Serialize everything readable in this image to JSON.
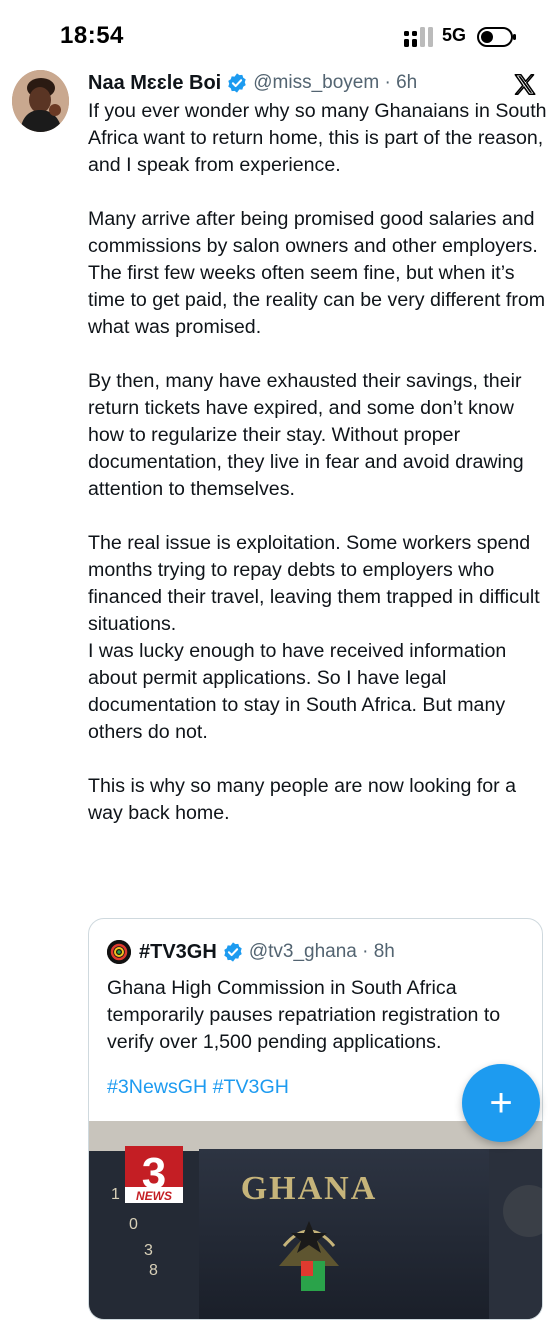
{
  "status_bar": {
    "time": "18:54",
    "network": "5G",
    "signal_icon": "signal-bars-icon",
    "battery_icon": "battery-icon"
  },
  "tweet": {
    "author_name": "Naa Mɛɛle Boi",
    "handle_time": "@miss_boyem · 6h",
    "verified_icon": "verified-badge-icon",
    "platform_icon": "x-logo-icon",
    "paragraphs": [
      "If you ever wonder why so many Ghanaians in South Africa want to return home, this is part of the reason, and I speak from experience.",
      "Many arrive after being promised good salaries and commissions by salon owners and other employers. The first few weeks often seem fine, but when it’s time to get paid, the reality can be very different from what was promised.",
      "By then, many have exhausted their savings, their return tickets have expired, and some don’t know how to regularize their stay. Without proper documentation, they live in fear and avoid drawing attention to themselves.",
      "The real issue is exploitation. Some workers spend months trying to repay debts to employers who financed their travel, leaving them trapped in difficult situations.\nI was lucky enough to have received information about permit applications. So I have legal documentation to stay in South Africa. But many others do not.",
      "This is why so many people are now looking for a way back home."
    ]
  },
  "quote": {
    "author_name": "#TV3GH",
    "handle_time": "@tv3_ghana · 8h",
    "text": "Ghana High Commission in South Africa temporarily pauses repatriation registration to verify over 1,500 pending applications.",
    "hashtags": "#3NewsGH #TV3GH",
    "media": {
      "logo_text": "NEWS",
      "sign_text": "GHANA",
      "gate_digits": [
        "1",
        "0",
        "3",
        "8"
      ]
    }
  },
  "fab": {
    "label": "+"
  },
  "colors": {
    "accent": "#1d9bf0",
    "text": "#0f1419",
    "muted": "#536471",
    "border": "#cfd9de"
  }
}
